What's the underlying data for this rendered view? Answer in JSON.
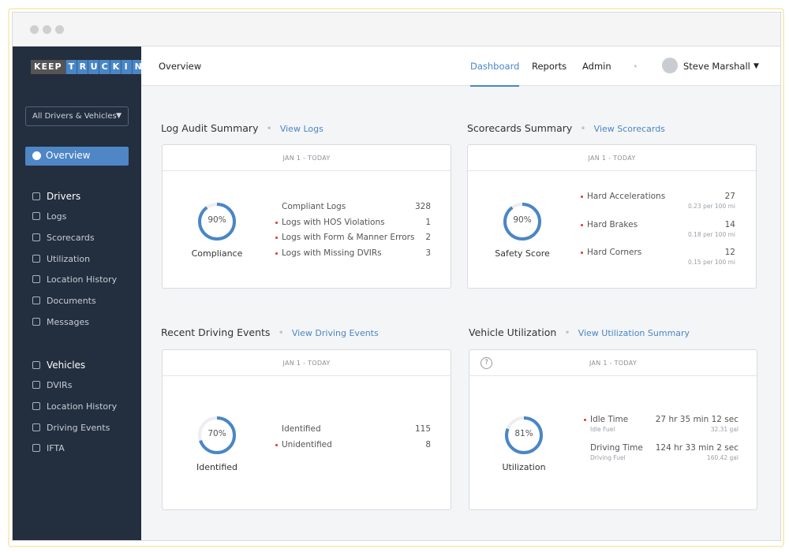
{
  "brand": {
    "logo_left": "KEEP",
    "logo_right": [
      "T",
      "R",
      "U",
      "C",
      "K",
      "I",
      "N"
    ]
  },
  "sidebar": {
    "filter": "All Drivers & Vehicles",
    "overview": "Overview",
    "drivers": {
      "label": "Drivers",
      "items": [
        "Logs",
        "Scorecards",
        "Utilization",
        "Location History",
        "Documents",
        "Messages"
      ]
    },
    "vehicles": {
      "label": "Vehicles",
      "items": [
        "DVIRs",
        "Location History",
        "Driving Events",
        "IFTA"
      ]
    }
  },
  "topbar": {
    "page": "Overview",
    "tabs": [
      "Dashboard",
      "Reports",
      "Admin"
    ],
    "active_tab": "Dashboard",
    "user": "Steve Marshall"
  },
  "colors": {
    "accent": "#4a86c5",
    "sidebar": "#232e3e",
    "alert": "#e0352b"
  },
  "log_audit": {
    "title": "Log Audit Summary",
    "link": "View Logs",
    "range": "JAN 1  -  TODAY",
    "percent": 90,
    "pct_text": "90%",
    "label": "Compliance",
    "rows": [
      {
        "label": "Compliant Logs",
        "value": "328",
        "alert": false
      },
      {
        "label": "Logs with HOS Violations",
        "value": "1",
        "alert": true
      },
      {
        "label": "Logs with Form & Manner Errors",
        "value": "2",
        "alert": true
      },
      {
        "label": "Logs with Missing DVIRs",
        "value": "3",
        "alert": true
      }
    ]
  },
  "scorecards": {
    "title": "Scorecards Summary",
    "link": "View Scorecards",
    "range": "JAN 1  -  TODAY",
    "percent": 90,
    "pct_text": "90%",
    "label": "Safety Score",
    "rows": [
      {
        "label": "Hard Accelerations",
        "value": "27",
        "sub": "0.23 per 100 mi"
      },
      {
        "label": "Hard Brakes",
        "value": "14",
        "sub": "0.18 per 100 mi"
      },
      {
        "label": "Hard Corners",
        "value": "12",
        "sub": "0.15 per 100 mi"
      }
    ]
  },
  "driving_events": {
    "title": "Recent Driving Events",
    "link": "View Driving Events",
    "range": "JAN 1  -  TODAY",
    "percent": 70,
    "pct_text": "70%",
    "label": "Identified",
    "rows": [
      {
        "label": "Identified",
        "value": "115",
        "alert": false
      },
      {
        "label": "Unidentified",
        "value": "8",
        "alert": true
      }
    ]
  },
  "utilization": {
    "title": "Vehicle Utilization",
    "link": "View Utilization Summary",
    "range": "JAN 1  -  TODAY",
    "help": "?",
    "percent": 81,
    "pct_text": "81%",
    "label": "Utilization",
    "rows": [
      {
        "label": "Idle Time",
        "sub": "Idle Fuel",
        "value": "27 hr 35 min 12 sec",
        "value_sub": "32.31 gal",
        "alert": true
      },
      {
        "label": "Driving Time",
        "sub": "Driving Fuel",
        "value": "124 hr 33 min 2 sec",
        "value_sub": "160.42 gal",
        "alert": false
      }
    ]
  }
}
